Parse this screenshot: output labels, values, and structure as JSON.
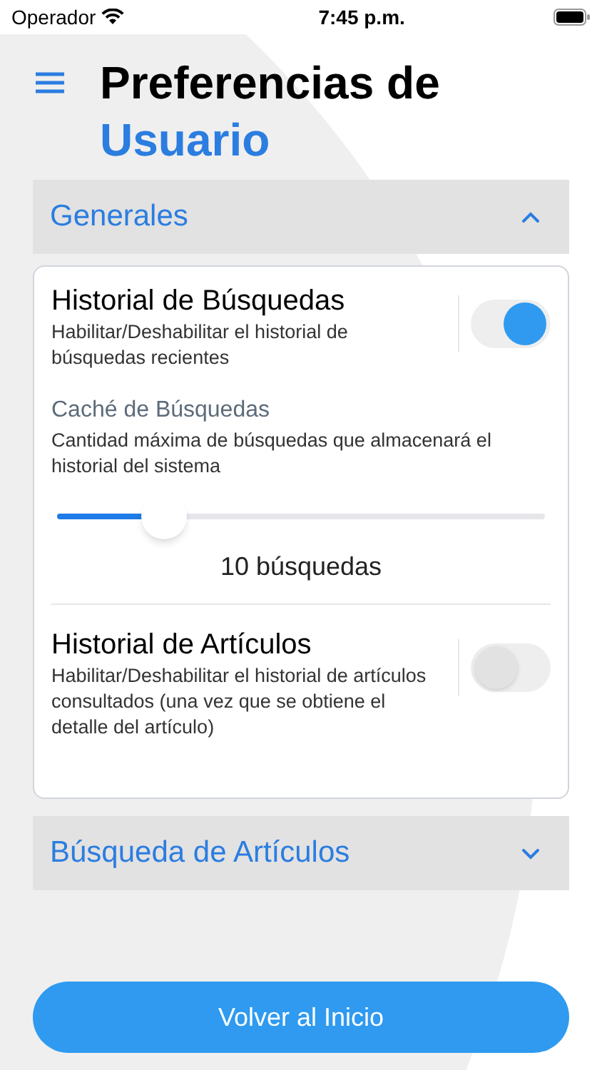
{
  "status_bar": {
    "carrier": "Operador",
    "time": "7:45 p.m."
  },
  "header": {
    "title_line_1": "Preferencias de",
    "title_line_2": "Usuario"
  },
  "sections": [
    {
      "title": "Generales",
      "expanded": true,
      "items": [
        {
          "kind": "toggle",
          "title": "Historial de Búsquedas",
          "description": "Habilitar/Deshabilitar el historial de búsquedas recientes",
          "on": true
        },
        {
          "kind": "slider",
          "title": "Caché de Búsquedas",
          "description": "Cantidad máxima de búsquedas que almacenará el historial del sistema",
          "level": 0.22,
          "reading": "10 búsquedas"
        },
        {
          "kind": "toggle",
          "title": "Historial de Artículos",
          "description": "Habilitar/Deshabilitar el historial de artículos consultados (una vez que se obtiene el detalle del artículo)",
          "on": false
        }
      ]
    },
    {
      "title": "Búsqueda de Artículos",
      "expanded": false
    }
  ],
  "footer_button": "Volver al Inicio"
}
